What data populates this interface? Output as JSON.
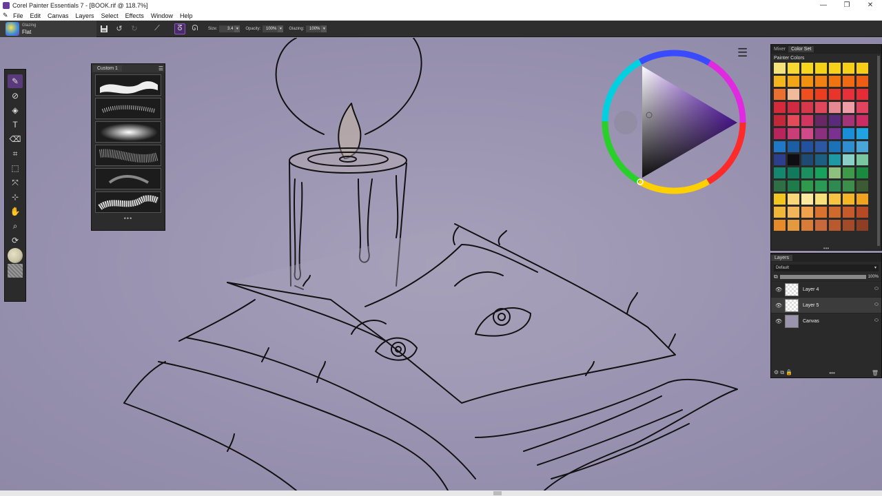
{
  "window": {
    "title": "Corel Painter Essentials 7 - [BOOK.rif @ 118.7%]",
    "controls": [
      "—",
      "❐",
      "✕"
    ]
  },
  "menu": [
    "File",
    "Edit",
    "Canvas",
    "Layers",
    "Select",
    "Effects",
    "Window",
    "Help"
  ],
  "property_bar": {
    "brush_category": "Glazing",
    "brush_variant": "Flat",
    "size_label": "Size:",
    "size_value": "3.4",
    "opacity_label": "Opacity:",
    "opacity_value": "100%",
    "glazing_label": "Glazing:",
    "glazing_value": "100%"
  },
  "brush_panel": {
    "tab": "Custom 1",
    "more": "•••"
  },
  "color_panel": {
    "tabs": [
      "Mixer",
      "Color Set"
    ],
    "active_tab": "Color Set",
    "title": "Painter Colors",
    "swatches": [
      "#f5e27a",
      "#f7d932",
      "#f8d61e",
      "#f6d217",
      "#f7d21a",
      "#f8cf18",
      "#f7cd16",
      "#f3b61e",
      "#f2a516",
      "#f29012",
      "#f08112",
      "#ee7412",
      "#ef6a12",
      "#ed5e14",
      "#eb6f2e",
      "#f0bb9a",
      "#ef4f1e",
      "#ec3d20",
      "#e9342a",
      "#e8303a",
      "#e52b36",
      "#d42a3a",
      "#cf2c44",
      "#d6384a",
      "#e1475a",
      "#e58a92",
      "#ef9ca6",
      "#e24460",
      "#c32838",
      "#e44a58",
      "#d23660",
      "#6a2766",
      "#5a2b7a",
      "#a43478",
      "#cb2c64",
      "#b8245c",
      "#c93e76",
      "#d04a88",
      "#8b2f7f",
      "#7a3190",
      "#1a8fd8",
      "#21a3e1",
      "#1f79c7",
      "#1b5ea4",
      "#2251a0",
      "#2c57a4",
      "#1b72b8",
      "#2e8ed0",
      "#48a6d8",
      "#2c3f8c",
      "#0d0d12",
      "#1e4a74",
      "#1c5f82",
      "#1f9aa4",
      "#8acfc8",
      "#7ac6a0",
      "#15876e",
      "#0f7b5c",
      "#1b8f60",
      "#17a35c",
      "#8ec07e",
      "#3c9a48",
      "#198a3e",
      "#2e6f46",
      "#1d7c4a",
      "#2f9a4c",
      "#2a9a54",
      "#2f8a52",
      "#3c8e4a",
      "#3c5a34",
      "#f1c61e",
      "#f8d77a",
      "#fbe9a2",
      "#f7e07a",
      "#f6c442",
      "#f4b628",
      "#f1a21e",
      "#f0b63a",
      "#f2b65a",
      "#f1a24a",
      "#d8722e",
      "#cd6a2c",
      "#c75a2a",
      "#b54a24",
      "#e68a2a",
      "#e39a3e",
      "#d97c38",
      "#c9683a",
      "#b85a2e",
      "#a34a28",
      "#8e3e22"
    ],
    "more": "•••"
  },
  "layers_panel": {
    "tab": "Layers",
    "composite_method": "Default",
    "opacity": "100%",
    "layers": [
      {
        "name": "Layer 4",
        "type": "layer"
      },
      {
        "name": "Layer 5",
        "type": "layer"
      },
      {
        "name": "Canvas",
        "type": "canvas"
      }
    ],
    "more": "•••"
  },
  "colors": {
    "accent": "#8a5ac0",
    "canvas_bg": "#9a94ad",
    "panel_bg": "#2a2a2a",
    "current_color": "#6b2fb8"
  }
}
